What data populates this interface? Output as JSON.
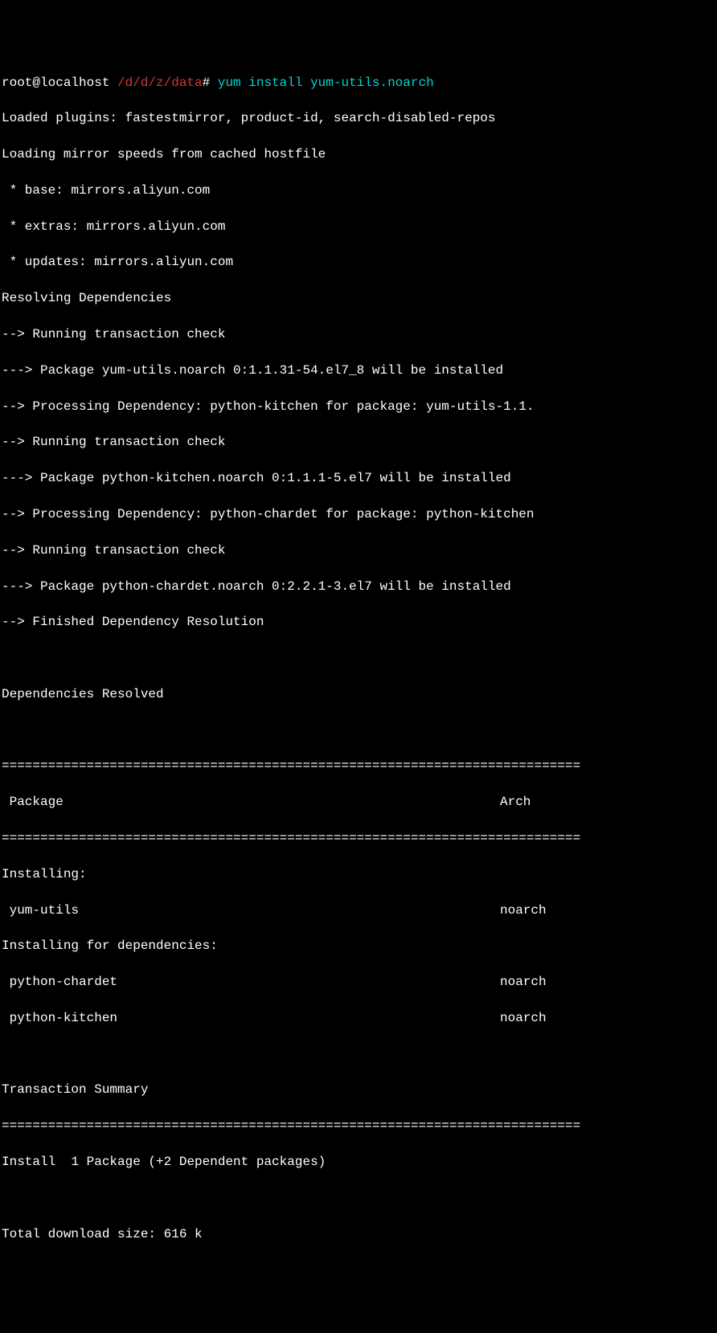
{
  "prompt": {
    "user_host": "root@localhost",
    "path": " /d/d/z/data",
    "hash": "# ",
    "command": "yum ",
    "action": "install ",
    "package": "yum-utils.noarch"
  },
  "output": {
    "loaded_plugins": "Loaded plugins: fastestmirror, product-id, search-disabled-repos",
    "loading_mirror": "Loading mirror speeds from cached hostfile",
    "mirror_base": " * base: mirrors.aliyun.com",
    "mirror_extras": " * extras: mirrors.aliyun.com",
    "mirror_updates": " * updates: mirrors.aliyun.com",
    "resolving": "Resolving Dependencies",
    "check1": "--> Running transaction check",
    "pkg1": "---> Package yum-utils.noarch 0:1.1.31-54.el7_8 will be installed",
    "dep1": "--> Processing Dependency: python-kitchen for package: yum-utils-1.1.",
    "check2": "--> Running transaction check",
    "pkg2": "---> Package python-kitchen.noarch 0:1.1.1-5.el7 will be installed",
    "dep2": "--> Processing Dependency: python-chardet for package: python-kitchen",
    "check3": "--> Running transaction check",
    "pkg3": "---> Package python-chardet.noarch 0:2.2.1-3.el7 will be installed",
    "finished": "--> Finished Dependency Resolution",
    "resolved": "Dependencies Resolved",
    "divider": "===========================================================================",
    "header_package": " Package",
    "header_arch": "Arch",
    "installing": "Installing:",
    "row1_pkg": " yum-utils",
    "row1_arch": "noarch",
    "installing_deps": "Installing for dependencies:",
    "row2_pkg": " python-chardet",
    "row2_arch": "noarch",
    "row3_pkg": " python-kitchen",
    "row3_arch": "noarch",
    "summary": "Transaction Summary",
    "install_count": "Install  1 Package (+2 Dependent packages)",
    "total_size": "Total download size: 616 k"
  }
}
